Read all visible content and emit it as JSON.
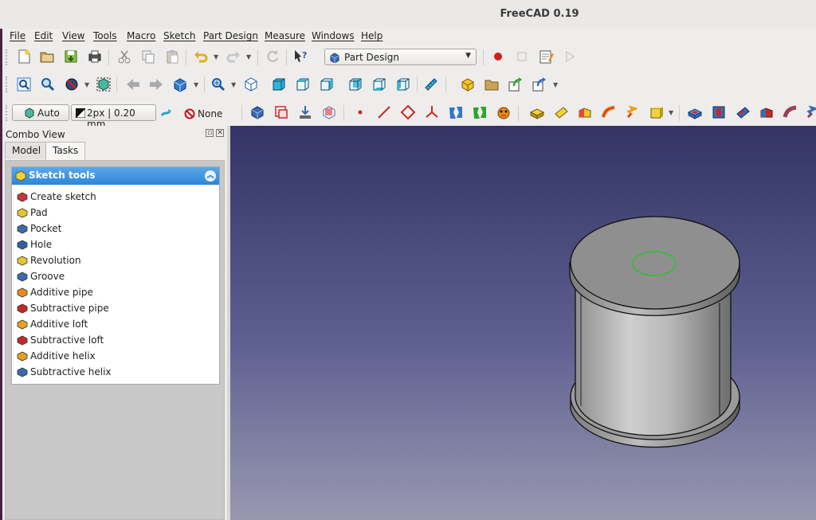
{
  "window": {
    "title": "FreeCAD 0.19"
  },
  "menu": [
    "File",
    "Edit",
    "View",
    "Tools",
    "Macro",
    "Sketch",
    "Part Design",
    "Measure",
    "Windows",
    "Help"
  ],
  "toolbar": {
    "workbench": "Part Design",
    "draw_style_label": "Auto",
    "line_width_label": "2px | 0.20 mm",
    "none_label": "None"
  },
  "combo": {
    "title": "Combo View",
    "tabs": [
      "Model",
      "Tasks"
    ],
    "active_tab": "Tasks",
    "panel_title": "Sketch tools",
    "items": [
      {
        "label": "Create sketch",
        "icon": "create-sketch-icon",
        "color": "#cc3333"
      },
      {
        "label": "Pad",
        "icon": "pad-icon",
        "color": "#e8c52a"
      },
      {
        "label": "Pocket",
        "icon": "pocket-icon",
        "color": "#3a6ab0"
      },
      {
        "label": "Hole",
        "icon": "hole-icon",
        "color": "#2f5fa5"
      },
      {
        "label": "Revolution",
        "icon": "revolution-icon",
        "color": "#e8c52a"
      },
      {
        "label": "Groove",
        "icon": "groove-icon",
        "color": "#3a6ab0"
      },
      {
        "label": "Additive pipe",
        "icon": "additive-pipe-icon",
        "color": "#e88a1a"
      },
      {
        "label": "Subtractive pipe",
        "icon": "subtractive-pipe-icon",
        "color": "#c62828"
      },
      {
        "label": "Additive loft",
        "icon": "additive-loft-icon",
        "color": "#e8a020"
      },
      {
        "label": "Subtractive loft",
        "icon": "subtractive-loft-icon",
        "color": "#c62828"
      },
      {
        "label": "Additive helix",
        "icon": "additive-helix-icon",
        "color": "#e8a020"
      },
      {
        "label": "Subtractive helix",
        "icon": "subtractive-helix-icon",
        "color": "#3a6ab0"
      }
    ]
  },
  "colors": {
    "view_top": "#333366",
    "view_bottom": "#9898b0",
    "panel_header": "#2d86d8",
    "sketch_circle": "#2fbf2f"
  }
}
